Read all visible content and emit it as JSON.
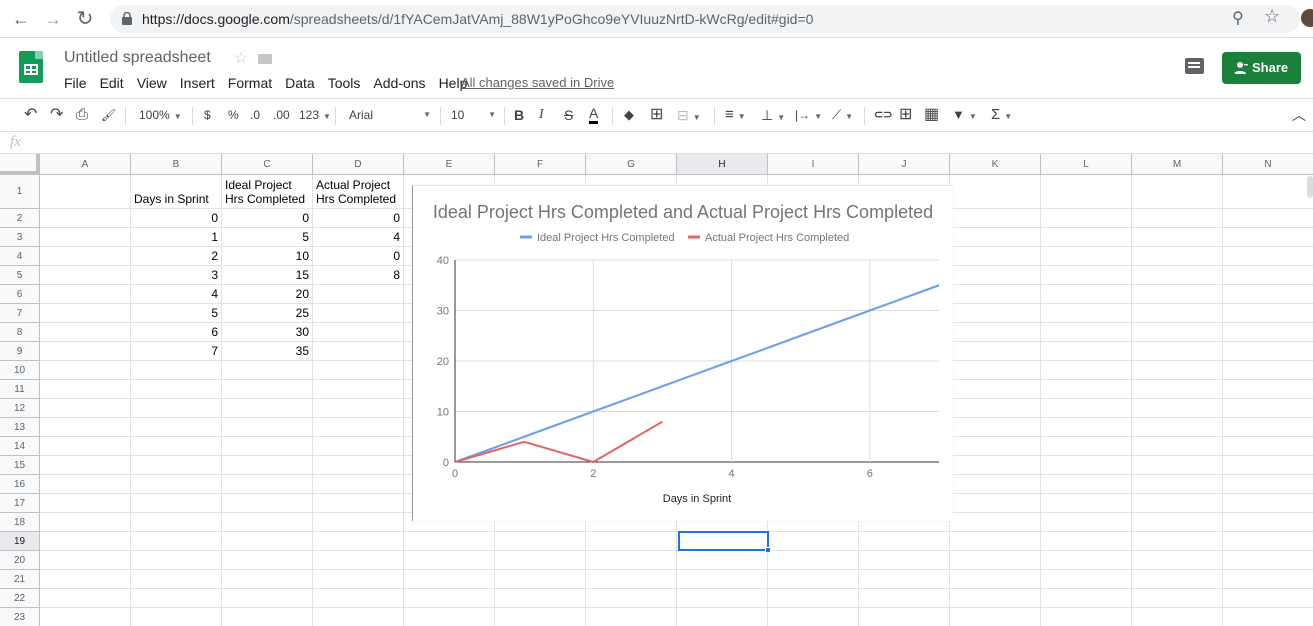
{
  "browser": {
    "url_host": "https://docs.google.com",
    "url_path": "/spreadsheets/d/1fYACemJatVAmj_88W1yPoGhco9eYVIuuzNrtD-kWcRg/edit#gid=0",
    "back_icon": "←",
    "forward_icon": "→",
    "reload_icon": "↻",
    "zoom_icon": "⚲",
    "star_icon": "☆"
  },
  "doc": {
    "title": "Untitled spreadsheet",
    "star_icon": "☆",
    "menus": [
      "File",
      "Edit",
      "View",
      "Insert",
      "Format",
      "Data",
      "Tools",
      "Add-ons",
      "Help"
    ],
    "saved_status": "All changes saved in Drive",
    "share_label": "Share"
  },
  "toolbar": {
    "undo": "↶",
    "redo": "↷",
    "print": "⎙",
    "paint": "🖌",
    "zoom": "100%",
    "currency": "$",
    "percent": "%",
    "dec_decrease": ".0",
    "dec_increase": ".00",
    "more_formats": "123",
    "font": "Arial",
    "font_size": "10",
    "bold": "B",
    "italic": "I",
    "strike": "S",
    "text_color": "A",
    "fill_color": "◆",
    "borders": "⊞",
    "merge": "⊟",
    "h_align": "≡",
    "v_align": "⊥",
    "wrap": "|→",
    "rotate": "⟋",
    "link": "⊂⊃",
    "comment": "⊞",
    "chart": "▦",
    "filter": "▼",
    "functions": "Σ",
    "collapse": "︿"
  },
  "formula_bar": {
    "fx_label": "fx",
    "value": ""
  },
  "grid": {
    "columns": [
      "A",
      "B",
      "C",
      "D",
      "E",
      "F",
      "G",
      "H",
      "I",
      "J",
      "K",
      "L",
      "M",
      "N"
    ],
    "selected_column": "H",
    "rows": [
      "1",
      "2",
      "3",
      "4",
      "5",
      "6",
      "7",
      "8",
      "9",
      "10",
      "11",
      "12",
      "13",
      "14",
      "15",
      "16",
      "17",
      "18",
      "19",
      "20",
      "21",
      "22",
      "23"
    ],
    "selected_row": "19",
    "headers": {
      "B1": "Days in Sprint",
      "C1": "Ideal Project Hrs Completed",
      "D1": "Actual Project Hrs Completed"
    },
    "b_values": [
      "0",
      "1",
      "2",
      "3",
      "4",
      "5",
      "6",
      "7"
    ],
    "c_values": [
      "0",
      "5",
      "10",
      "15",
      "20",
      "25",
      "30",
      "35"
    ],
    "d_values": [
      "0",
      "4",
      "0",
      "8"
    ]
  },
  "chart_data": {
    "type": "line",
    "title": "Ideal Project Hrs Completed and Actual Project Hrs Completed",
    "xlabel": "Days in Sprint",
    "ylabel": "",
    "xlim": [
      0,
      7
    ],
    "ylim": [
      0,
      40
    ],
    "x_ticks": [
      "0",
      "2",
      "4",
      "6"
    ],
    "y_ticks": [
      "0",
      "10",
      "20",
      "30",
      "40"
    ],
    "grid": true,
    "legend": "top",
    "series": [
      {
        "name": "Ideal Project Hrs Completed",
        "color": "#6d9eeb",
        "x": [
          0,
          1,
          2,
          3,
          4,
          5,
          6,
          7
        ],
        "values": [
          0,
          5,
          10,
          15,
          20,
          25,
          30,
          35
        ]
      },
      {
        "name": "Actual Project Hrs Completed",
        "color": "#e06666",
        "x": [
          0,
          1,
          2,
          3
        ],
        "values": [
          0,
          4,
          0,
          8
        ]
      }
    ]
  }
}
